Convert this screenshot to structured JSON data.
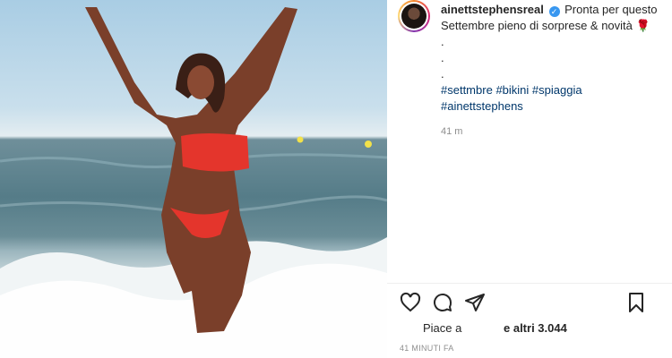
{
  "post": {
    "username": "ainettstephensreal",
    "caption_text": "Pronta per questo Settembre pieno di sorprese & novità",
    "caption_emoji": "🌹",
    "dots": [
      ".",
      ".",
      "."
    ],
    "hashtags": [
      "#settmbre",
      "#bikini",
      "#spiaggia",
      "#ainettstephens"
    ],
    "caption_age": "41 m"
  },
  "actions": {
    "like_icon": "heart-icon",
    "comment_icon": "comment-icon",
    "share_icon": "send-icon",
    "save_icon": "bookmark-icon"
  },
  "likes": {
    "prefix": "Piace a",
    "others": "e altri 3.044"
  },
  "timestamp": "41 MINUTI FA",
  "colors": {
    "link": "#00376b",
    "verified": "#3897f0",
    "muted": "#8e8e8e"
  }
}
